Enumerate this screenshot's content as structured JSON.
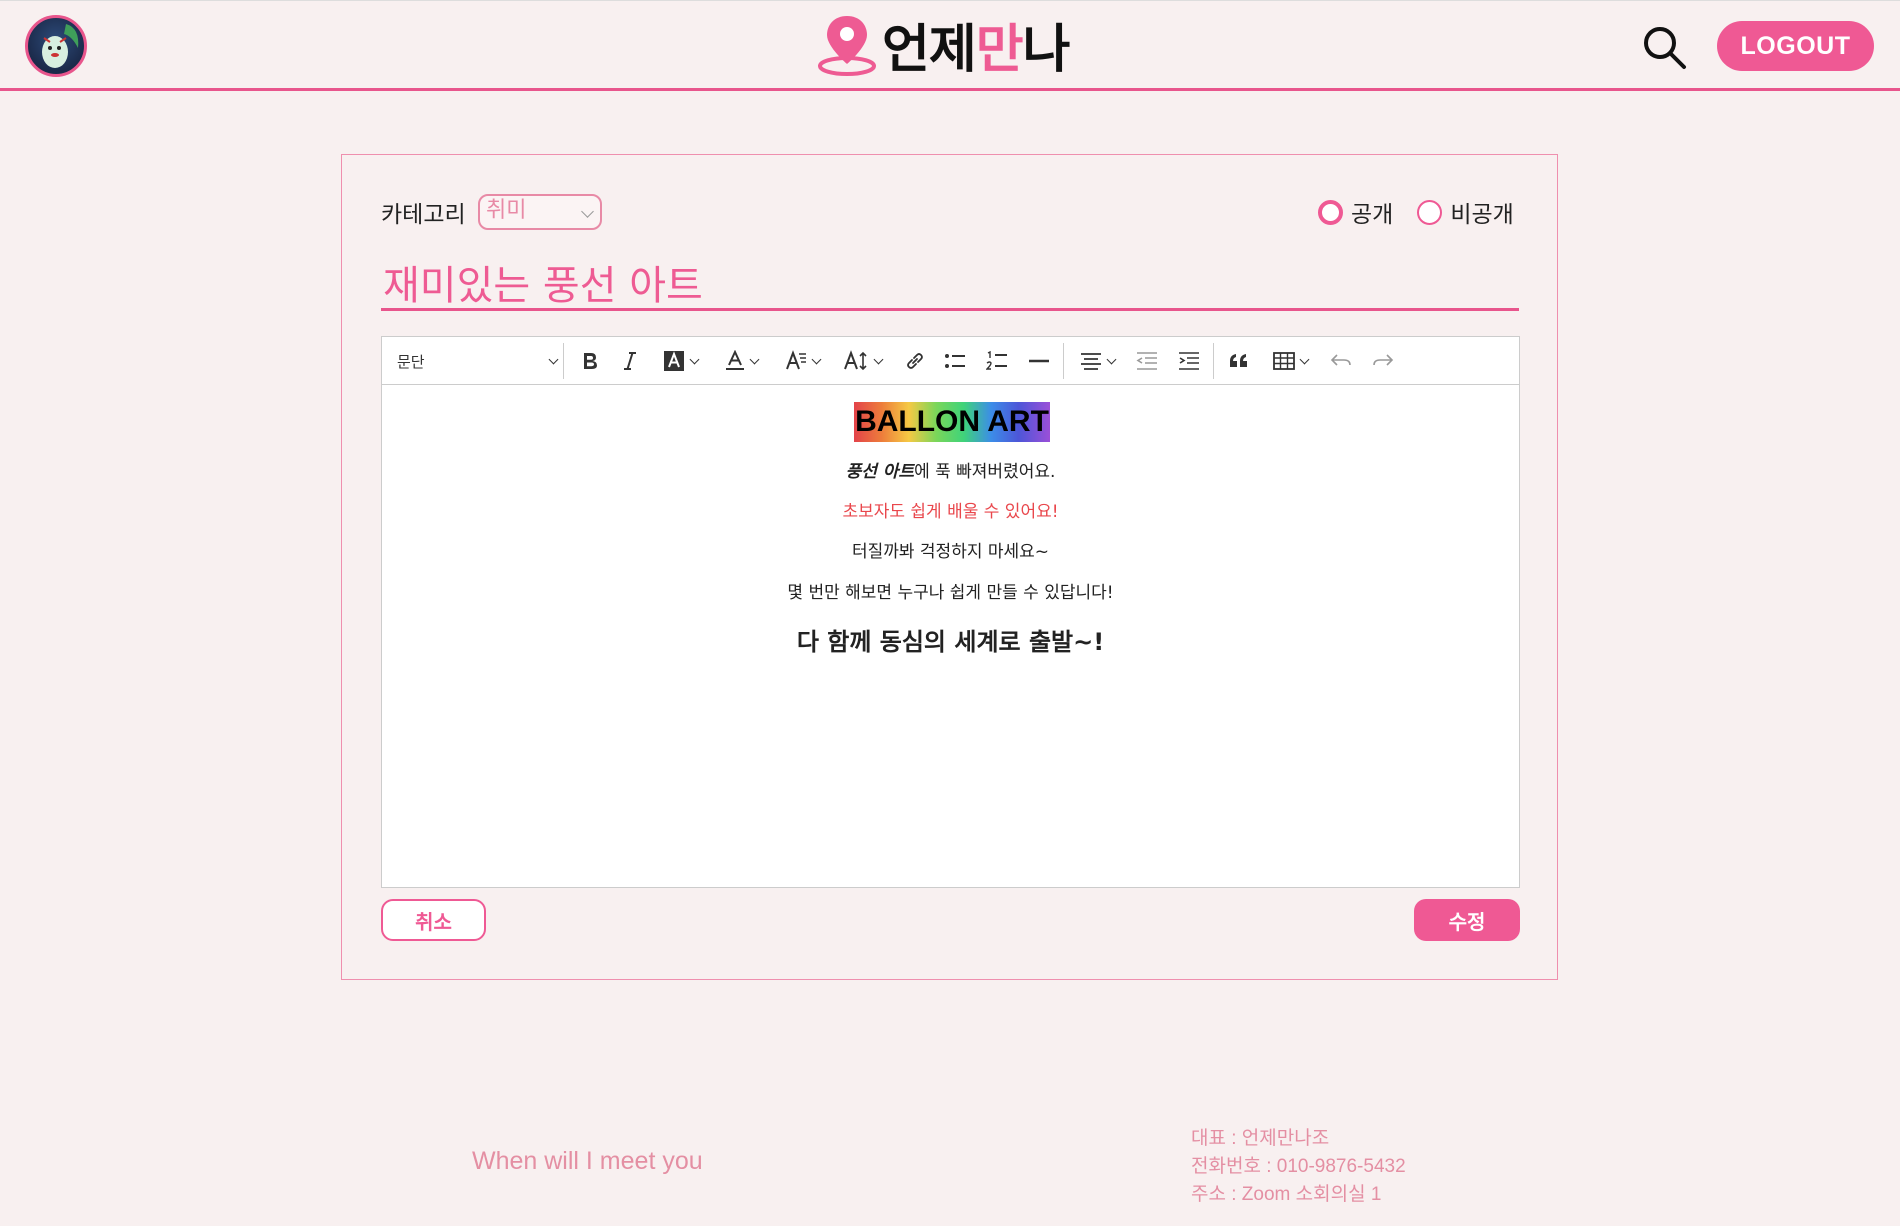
{
  "header": {
    "logo_text_a": "언제",
    "logo_text_b": "만",
    "logo_text_c": "나",
    "logout_label": "LOGOUT",
    "accent_color": "#ef5994"
  },
  "form": {
    "category_label": "카테고리",
    "category_value": "취미",
    "visibility_options": [
      {
        "label": "공개",
        "checked": true
      },
      {
        "label": "비공개",
        "checked": false
      }
    ],
    "title_value": "재미있는 풍선 아트"
  },
  "toolbar": {
    "paragraph_label": "문단",
    "icons": [
      "bold-icon",
      "italic-icon",
      "highlight-icon",
      "font-color-icon",
      "font-size-icon",
      "text-case-icon",
      "link-icon",
      "bullet-list-icon",
      "numbered-list-icon",
      "horizontal-line-icon",
      "align-icon",
      "outdent-icon",
      "indent-icon",
      "quote-icon",
      "table-icon",
      "undo-icon",
      "redo-icon"
    ]
  },
  "content": {
    "heading": "BALLON ART",
    "line1_bold": "풍선 아트",
    "line1_rest": "에 푹 빠져버렸어요.",
    "line2": "초보자도 쉽게 배울 수 있어요!",
    "line3": "터질까봐 걱정하지 마세요~",
    "line4": "몇 번만 해보면 누구나 쉽게 만들 수 있답니다!",
    "line5": "다 함께 동심의 세계로 출발~!"
  },
  "actions": {
    "cancel_label": "취소",
    "edit_label": "수정"
  },
  "footer": {
    "tagline": "When will I meet you",
    "rep": "대표 : 언제만나조",
    "phone": "전화번호 : 010-9876-5432",
    "address": "주소 : Zoom 소회의실 1"
  }
}
